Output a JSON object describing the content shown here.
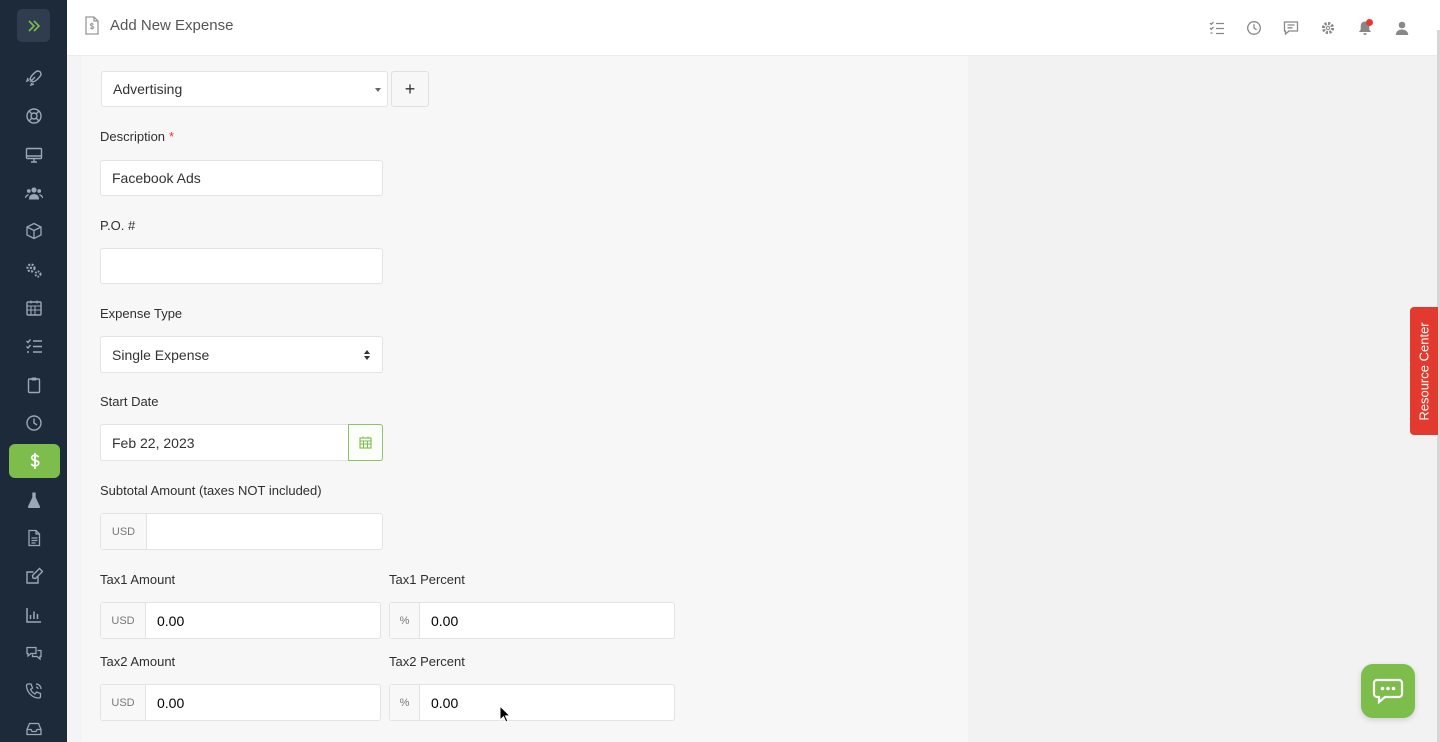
{
  "header": {
    "title": "Add New Expense"
  },
  "category": {
    "value": "Advertising",
    "add_label": "+"
  },
  "description": {
    "label": "Description",
    "required_mark": "*",
    "value": "Facebook Ads"
  },
  "po": {
    "label": "P.O. #",
    "value": ""
  },
  "expense_type": {
    "label": "Expense Type",
    "value": "Single Expense"
  },
  "start_date": {
    "label": "Start Date",
    "value": "Feb 22, 2023"
  },
  "subtotal": {
    "label": "Subtotal Amount (taxes NOT included)",
    "currency": "USD",
    "value": ""
  },
  "tax1_amount": {
    "label": "Tax1 Amount",
    "currency": "USD",
    "value": "0.00"
  },
  "tax1_percent": {
    "label": "Tax1 Percent",
    "unit": "%",
    "value": "0.00"
  },
  "tax2_amount": {
    "label": "Tax2 Amount",
    "currency": "USD",
    "value": "0.00"
  },
  "tax2_percent": {
    "label": "Tax2 Percent",
    "unit": "%",
    "value": "0.00"
  },
  "resource_center": {
    "label": "Resource Center"
  },
  "colors": {
    "sidebar": "#1d2a3a",
    "accent": "#7cbd4b",
    "resource": "#e23a2e"
  },
  "sidebar": {
    "items": [
      {
        "icon": "rocket-icon"
      },
      {
        "icon": "lifebuoy-icon"
      },
      {
        "icon": "monitor-icon"
      },
      {
        "icon": "users-icon"
      },
      {
        "icon": "box-icon"
      },
      {
        "icon": "gears-icon"
      },
      {
        "icon": "calendar-icon"
      },
      {
        "icon": "tasks-icon"
      },
      {
        "icon": "clipboard-icon"
      },
      {
        "icon": "clock-icon"
      },
      {
        "icon": "dollar-icon",
        "active": true
      },
      {
        "icon": "flask-icon"
      },
      {
        "icon": "document-icon"
      },
      {
        "icon": "edit-icon"
      },
      {
        "icon": "chart-icon"
      },
      {
        "icon": "chat-bubbles-icon"
      },
      {
        "icon": "phone-icon"
      },
      {
        "icon": "inbox-icon"
      }
    ]
  }
}
